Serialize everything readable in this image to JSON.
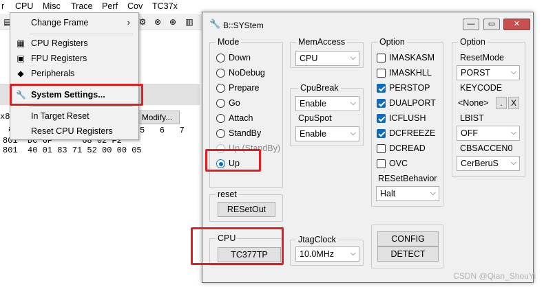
{
  "menubar": [
    "r",
    "CPU",
    "Misc",
    "Trace",
    "Perf",
    "Cov",
    "TC37x"
  ],
  "toolbar_icons": [
    "memory-icon",
    "gear-icon",
    "binoculars-icon",
    "glasses-icon",
    "list-icon"
  ],
  "bg_window": {
    "addr_prefix": "x80",
    "modify_label": "Modify...",
    "col_row": "5   6   7",
    "row1": "801  DC 6F      68 02 F2",
    "row2": "801  40 01 83 71 52 00 00 05",
    "frag": "a"
  },
  "dropdown": {
    "items": [
      {
        "label": "Change Frame",
        "icon": "",
        "submenu": true
      },
      {
        "label": "CPU Registers",
        "icon": "registers-icon"
      },
      {
        "label": "FPU Registers",
        "icon": "fpu-icon"
      },
      {
        "label": "Peripherals",
        "icon": "chip-icon"
      },
      {
        "label": "System Settings...",
        "icon": "wrench-icon"
      },
      {
        "label": "In Target Reset",
        "icon": ""
      },
      {
        "label": "Reset CPU Registers",
        "icon": ""
      }
    ]
  },
  "dialog": {
    "title": "B::SYStem",
    "mode": {
      "label": "Mode",
      "options": [
        "Down",
        "NoDebug",
        "Prepare",
        "Go",
        "Attach",
        "StandBy",
        "Up (StandBy)",
        "Up"
      ],
      "selected": "Up"
    },
    "memaccess": {
      "label": "MemAccess",
      "value": "CPU"
    },
    "cpubreak": {
      "label": "CpuBreak",
      "value": "Enable"
    },
    "cpuspot": {
      "label": "CpuSpot",
      "value": "Enable"
    },
    "option1": {
      "label": "Option",
      "items": [
        {
          "label": "IMASKASM",
          "checked": false
        },
        {
          "label": "IMASKHLL",
          "checked": false
        },
        {
          "label": "PERSTOP",
          "checked": true
        },
        {
          "label": "DUALPORT",
          "checked": true
        },
        {
          "label": "ICFLUSH",
          "checked": true
        },
        {
          "label": "DCFREEZE",
          "checked": true
        },
        {
          "label": "DCREAD",
          "checked": false
        },
        {
          "label": "OVC",
          "checked": false
        }
      ],
      "resetbehavior_label": "RESetBehavior",
      "resetbehavior_value": "Halt"
    },
    "option2": {
      "label": "Option",
      "resetmode_label": "ResetMode",
      "resetmode_value": "PORST",
      "keycode_label": "KEYCODE",
      "keycode_value": "<None>",
      "keycode_btn1": ".",
      "keycode_btn2": "X",
      "lbist_label": "LBIST",
      "lbist_value": "OFF",
      "cbsacc_label": "CBSACCEN0",
      "cbsacc_value": "CerBeruS"
    },
    "reset": {
      "label": "reset",
      "button": "RESetOut"
    },
    "cpu": {
      "label": "CPU",
      "button": "TC377TP"
    },
    "jtagclock": {
      "label": "JtagClock",
      "value": "10.0MHz"
    },
    "config_button": "CONFIG",
    "detect_button": "DETECT"
  },
  "watermark": "CSDN @Qian_ShouYi",
  "colors": {
    "accent": "#0f6cbd",
    "highlight": "#e02020"
  }
}
